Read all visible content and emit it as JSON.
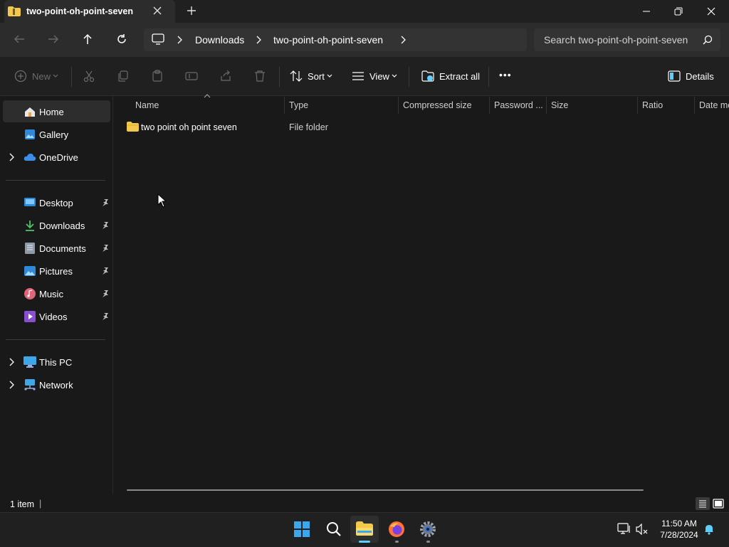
{
  "tab": {
    "title": "two-point-oh-point-seven"
  },
  "breadcrumb": [
    "Downloads",
    "two-point-oh-point-seven"
  ],
  "search": {
    "placeholder": "Search two-point-oh-point-seven"
  },
  "toolbar": {
    "new_label": "New",
    "sort_label": "Sort",
    "view_label": "View",
    "extract_label": "Extract all",
    "more_label": "•••",
    "details_label": "Details"
  },
  "sidebar": {
    "top": [
      {
        "label": "Home",
        "icon": "home-icon",
        "selected": true
      },
      {
        "label": "Gallery",
        "icon": "gallery-icon"
      },
      {
        "label": "OneDrive",
        "icon": "onedrive-icon",
        "expandable": true
      }
    ],
    "pinned": [
      {
        "label": "Desktop",
        "icon": "desktop-icon"
      },
      {
        "label": "Downloads",
        "icon": "downloads-icon"
      },
      {
        "label": "Documents",
        "icon": "documents-icon"
      },
      {
        "label": "Pictures",
        "icon": "pictures-icon"
      },
      {
        "label": "Music",
        "icon": "music-icon"
      },
      {
        "label": "Videos",
        "icon": "videos-icon"
      }
    ],
    "bottom": [
      {
        "label": "This PC",
        "icon": "this-pc-icon"
      },
      {
        "label": "Network",
        "icon": "network-icon"
      }
    ]
  },
  "columns": [
    "Name",
    "Type",
    "Compressed size",
    "Password ...",
    "Size",
    "Ratio",
    "Date mo"
  ],
  "files": [
    {
      "name": "two point oh point seven",
      "type": "File folder"
    }
  ],
  "status": {
    "count": "1 item",
    "cursor": "|"
  },
  "clock": {
    "time": "11:50 AM",
    "date": "7/28/2024"
  },
  "colors": {
    "accent": "#60cdff",
    "folder": "#f3c94b",
    "background": "#191919"
  }
}
